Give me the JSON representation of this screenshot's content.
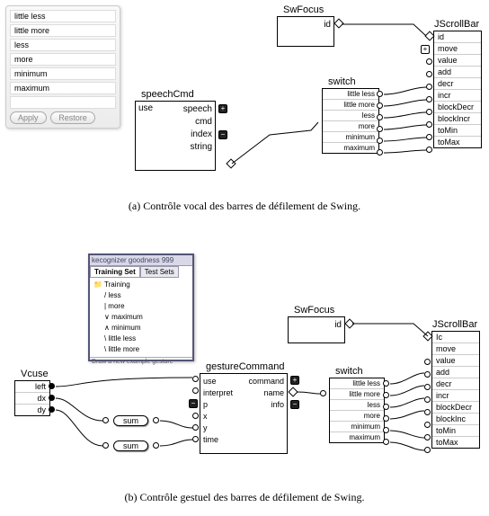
{
  "figA": {
    "settings": {
      "items": [
        "little less",
        "little more",
        "less",
        "more",
        "minimum",
        "maximum"
      ],
      "apply": "Apply",
      "restore": "Restore"
    },
    "speechCmd": {
      "title": "speechCmd",
      "left": [
        "use"
      ],
      "right": [
        "speech",
        "cmd",
        "index",
        "string"
      ]
    },
    "swFocus": {
      "title": "SwFocus",
      "right": [
        "id"
      ]
    },
    "switch": {
      "title": "switch",
      "items": [
        "little less",
        "little more",
        "less",
        "more",
        "minimum",
        "maximum"
      ]
    },
    "jscrollbar": {
      "title": "JScrollBar",
      "items": [
        "id",
        "move",
        "value",
        "add",
        "decr",
        "incr",
        "blockDecr",
        "blockIncr",
        "toMin",
        "toMax"
      ]
    },
    "caption": "(a) Contrôle vocal des barres de défilement de Swing."
  },
  "figB": {
    "recognizer": {
      "header": "kecognizer goodness   999",
      "tab1": "Training Set",
      "tab2": "Test Sets",
      "root": "Training",
      "items": [
        "/ less",
        "| more",
        "∨ maximum",
        "∧ minimum",
        "\\ little less",
        "\\ little more"
      ],
      "footer": "Draw a new example gesture"
    },
    "vcuse": {
      "title": "Vcuse",
      "items": [
        "left",
        "dx",
        "dy"
      ]
    },
    "gestureCommand": {
      "title": "gestureCommand",
      "left": [
        "use",
        "interpret",
        "p",
        "x",
        "y",
        "time"
      ],
      "right": [
        "command",
        "name",
        "info"
      ]
    },
    "swFocus": {
      "title": "SwFocus",
      "right": [
        "id"
      ]
    },
    "switch": {
      "title": "switch",
      "items": [
        "little less",
        "little more",
        "less",
        "more",
        "minimum",
        "maximum"
      ]
    },
    "jscrollbar": {
      "title": "JScrollBar",
      "items": [
        "Ic",
        "move",
        "value",
        "add",
        "decr",
        "incr",
        "blockDecr",
        "blockInc",
        "toMin",
        "toMax"
      ]
    },
    "sum": "sum",
    "caption": "(b) Contrôle gestuel des barres de défilement de Swing."
  }
}
